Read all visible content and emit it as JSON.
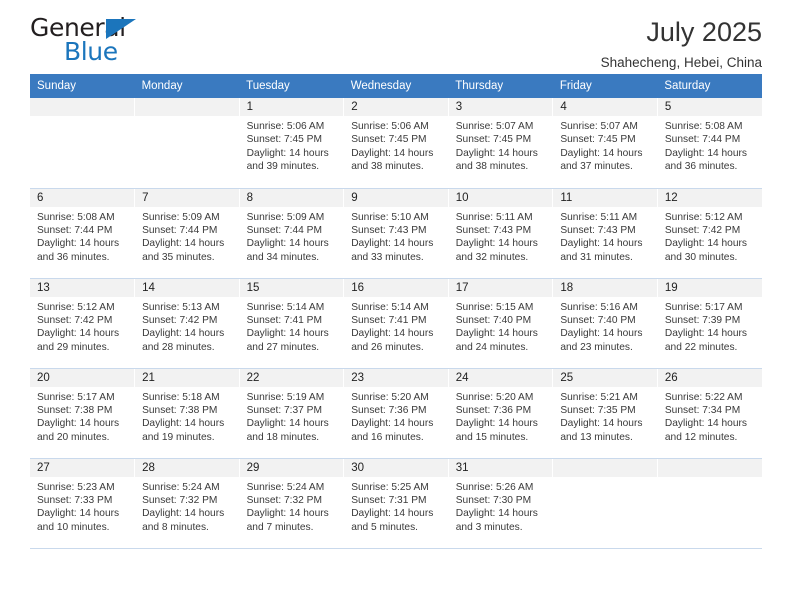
{
  "brand": {
    "name_part1": "General",
    "name_part2": "Blue",
    "triangle_color": "#1b75bc"
  },
  "header": {
    "title": "July 2025",
    "subtitle": "Shahecheng, Hebei, China"
  },
  "weekdays": [
    "Sunday",
    "Monday",
    "Tuesday",
    "Wednesday",
    "Thursday",
    "Friday",
    "Saturday"
  ],
  "theme": {
    "header_bar": "#3a7ac0",
    "day_band": "#f2f2f2",
    "row_divider": "#c9d9ec"
  },
  "weeks": [
    [
      {
        "day": "",
        "sunrise": "",
        "sunset": "",
        "daylight1": "",
        "daylight2": ""
      },
      {
        "day": "",
        "sunrise": "",
        "sunset": "",
        "daylight1": "",
        "daylight2": ""
      },
      {
        "day": "1",
        "sunrise": "Sunrise: 5:06 AM",
        "sunset": "Sunset: 7:45 PM",
        "daylight1": "Daylight: 14 hours",
        "daylight2": "and 39 minutes."
      },
      {
        "day": "2",
        "sunrise": "Sunrise: 5:06 AM",
        "sunset": "Sunset: 7:45 PM",
        "daylight1": "Daylight: 14 hours",
        "daylight2": "and 38 minutes."
      },
      {
        "day": "3",
        "sunrise": "Sunrise: 5:07 AM",
        "sunset": "Sunset: 7:45 PM",
        "daylight1": "Daylight: 14 hours",
        "daylight2": "and 38 minutes."
      },
      {
        "day": "4",
        "sunrise": "Sunrise: 5:07 AM",
        "sunset": "Sunset: 7:45 PM",
        "daylight1": "Daylight: 14 hours",
        "daylight2": "and 37 minutes."
      },
      {
        "day": "5",
        "sunrise": "Sunrise: 5:08 AM",
        "sunset": "Sunset: 7:44 PM",
        "daylight1": "Daylight: 14 hours",
        "daylight2": "and 36 minutes."
      }
    ],
    [
      {
        "day": "6",
        "sunrise": "Sunrise: 5:08 AM",
        "sunset": "Sunset: 7:44 PM",
        "daylight1": "Daylight: 14 hours",
        "daylight2": "and 36 minutes."
      },
      {
        "day": "7",
        "sunrise": "Sunrise: 5:09 AM",
        "sunset": "Sunset: 7:44 PM",
        "daylight1": "Daylight: 14 hours",
        "daylight2": "and 35 minutes."
      },
      {
        "day": "8",
        "sunrise": "Sunrise: 5:09 AM",
        "sunset": "Sunset: 7:44 PM",
        "daylight1": "Daylight: 14 hours",
        "daylight2": "and 34 minutes."
      },
      {
        "day": "9",
        "sunrise": "Sunrise: 5:10 AM",
        "sunset": "Sunset: 7:43 PM",
        "daylight1": "Daylight: 14 hours",
        "daylight2": "and 33 minutes."
      },
      {
        "day": "10",
        "sunrise": "Sunrise: 5:11 AM",
        "sunset": "Sunset: 7:43 PM",
        "daylight1": "Daylight: 14 hours",
        "daylight2": "and 32 minutes."
      },
      {
        "day": "11",
        "sunrise": "Sunrise: 5:11 AM",
        "sunset": "Sunset: 7:43 PM",
        "daylight1": "Daylight: 14 hours",
        "daylight2": "and 31 minutes."
      },
      {
        "day": "12",
        "sunrise": "Sunrise: 5:12 AM",
        "sunset": "Sunset: 7:42 PM",
        "daylight1": "Daylight: 14 hours",
        "daylight2": "and 30 minutes."
      }
    ],
    [
      {
        "day": "13",
        "sunrise": "Sunrise: 5:12 AM",
        "sunset": "Sunset: 7:42 PM",
        "daylight1": "Daylight: 14 hours",
        "daylight2": "and 29 minutes."
      },
      {
        "day": "14",
        "sunrise": "Sunrise: 5:13 AM",
        "sunset": "Sunset: 7:42 PM",
        "daylight1": "Daylight: 14 hours",
        "daylight2": "and 28 minutes."
      },
      {
        "day": "15",
        "sunrise": "Sunrise: 5:14 AM",
        "sunset": "Sunset: 7:41 PM",
        "daylight1": "Daylight: 14 hours",
        "daylight2": "and 27 minutes."
      },
      {
        "day": "16",
        "sunrise": "Sunrise: 5:14 AM",
        "sunset": "Sunset: 7:41 PM",
        "daylight1": "Daylight: 14 hours",
        "daylight2": "and 26 minutes."
      },
      {
        "day": "17",
        "sunrise": "Sunrise: 5:15 AM",
        "sunset": "Sunset: 7:40 PM",
        "daylight1": "Daylight: 14 hours",
        "daylight2": "and 24 minutes."
      },
      {
        "day": "18",
        "sunrise": "Sunrise: 5:16 AM",
        "sunset": "Sunset: 7:40 PM",
        "daylight1": "Daylight: 14 hours",
        "daylight2": "and 23 minutes."
      },
      {
        "day": "19",
        "sunrise": "Sunrise: 5:17 AM",
        "sunset": "Sunset: 7:39 PM",
        "daylight1": "Daylight: 14 hours",
        "daylight2": "and 22 minutes."
      }
    ],
    [
      {
        "day": "20",
        "sunrise": "Sunrise: 5:17 AM",
        "sunset": "Sunset: 7:38 PM",
        "daylight1": "Daylight: 14 hours",
        "daylight2": "and 20 minutes."
      },
      {
        "day": "21",
        "sunrise": "Sunrise: 5:18 AM",
        "sunset": "Sunset: 7:38 PM",
        "daylight1": "Daylight: 14 hours",
        "daylight2": "and 19 minutes."
      },
      {
        "day": "22",
        "sunrise": "Sunrise: 5:19 AM",
        "sunset": "Sunset: 7:37 PM",
        "daylight1": "Daylight: 14 hours",
        "daylight2": "and 18 minutes."
      },
      {
        "day": "23",
        "sunrise": "Sunrise: 5:20 AM",
        "sunset": "Sunset: 7:36 PM",
        "daylight1": "Daylight: 14 hours",
        "daylight2": "and 16 minutes."
      },
      {
        "day": "24",
        "sunrise": "Sunrise: 5:20 AM",
        "sunset": "Sunset: 7:36 PM",
        "daylight1": "Daylight: 14 hours",
        "daylight2": "and 15 minutes."
      },
      {
        "day": "25",
        "sunrise": "Sunrise: 5:21 AM",
        "sunset": "Sunset: 7:35 PM",
        "daylight1": "Daylight: 14 hours",
        "daylight2": "and 13 minutes."
      },
      {
        "day": "26",
        "sunrise": "Sunrise: 5:22 AM",
        "sunset": "Sunset: 7:34 PM",
        "daylight1": "Daylight: 14 hours",
        "daylight2": "and 12 minutes."
      }
    ],
    [
      {
        "day": "27",
        "sunrise": "Sunrise: 5:23 AM",
        "sunset": "Sunset: 7:33 PM",
        "daylight1": "Daylight: 14 hours",
        "daylight2": "and 10 minutes."
      },
      {
        "day": "28",
        "sunrise": "Sunrise: 5:24 AM",
        "sunset": "Sunset: 7:32 PM",
        "daylight1": "Daylight: 14 hours",
        "daylight2": "and 8 minutes."
      },
      {
        "day": "29",
        "sunrise": "Sunrise: 5:24 AM",
        "sunset": "Sunset: 7:32 PM",
        "daylight1": "Daylight: 14 hours",
        "daylight2": "and 7 minutes."
      },
      {
        "day": "30",
        "sunrise": "Sunrise: 5:25 AM",
        "sunset": "Sunset: 7:31 PM",
        "daylight1": "Daylight: 14 hours",
        "daylight2": "and 5 minutes."
      },
      {
        "day": "31",
        "sunrise": "Sunrise: 5:26 AM",
        "sunset": "Sunset: 7:30 PM",
        "daylight1": "Daylight: 14 hours",
        "daylight2": "and 3 minutes."
      },
      {
        "day": "",
        "sunrise": "",
        "sunset": "",
        "daylight1": "",
        "daylight2": ""
      },
      {
        "day": "",
        "sunrise": "",
        "sunset": "",
        "daylight1": "",
        "daylight2": ""
      }
    ]
  ]
}
